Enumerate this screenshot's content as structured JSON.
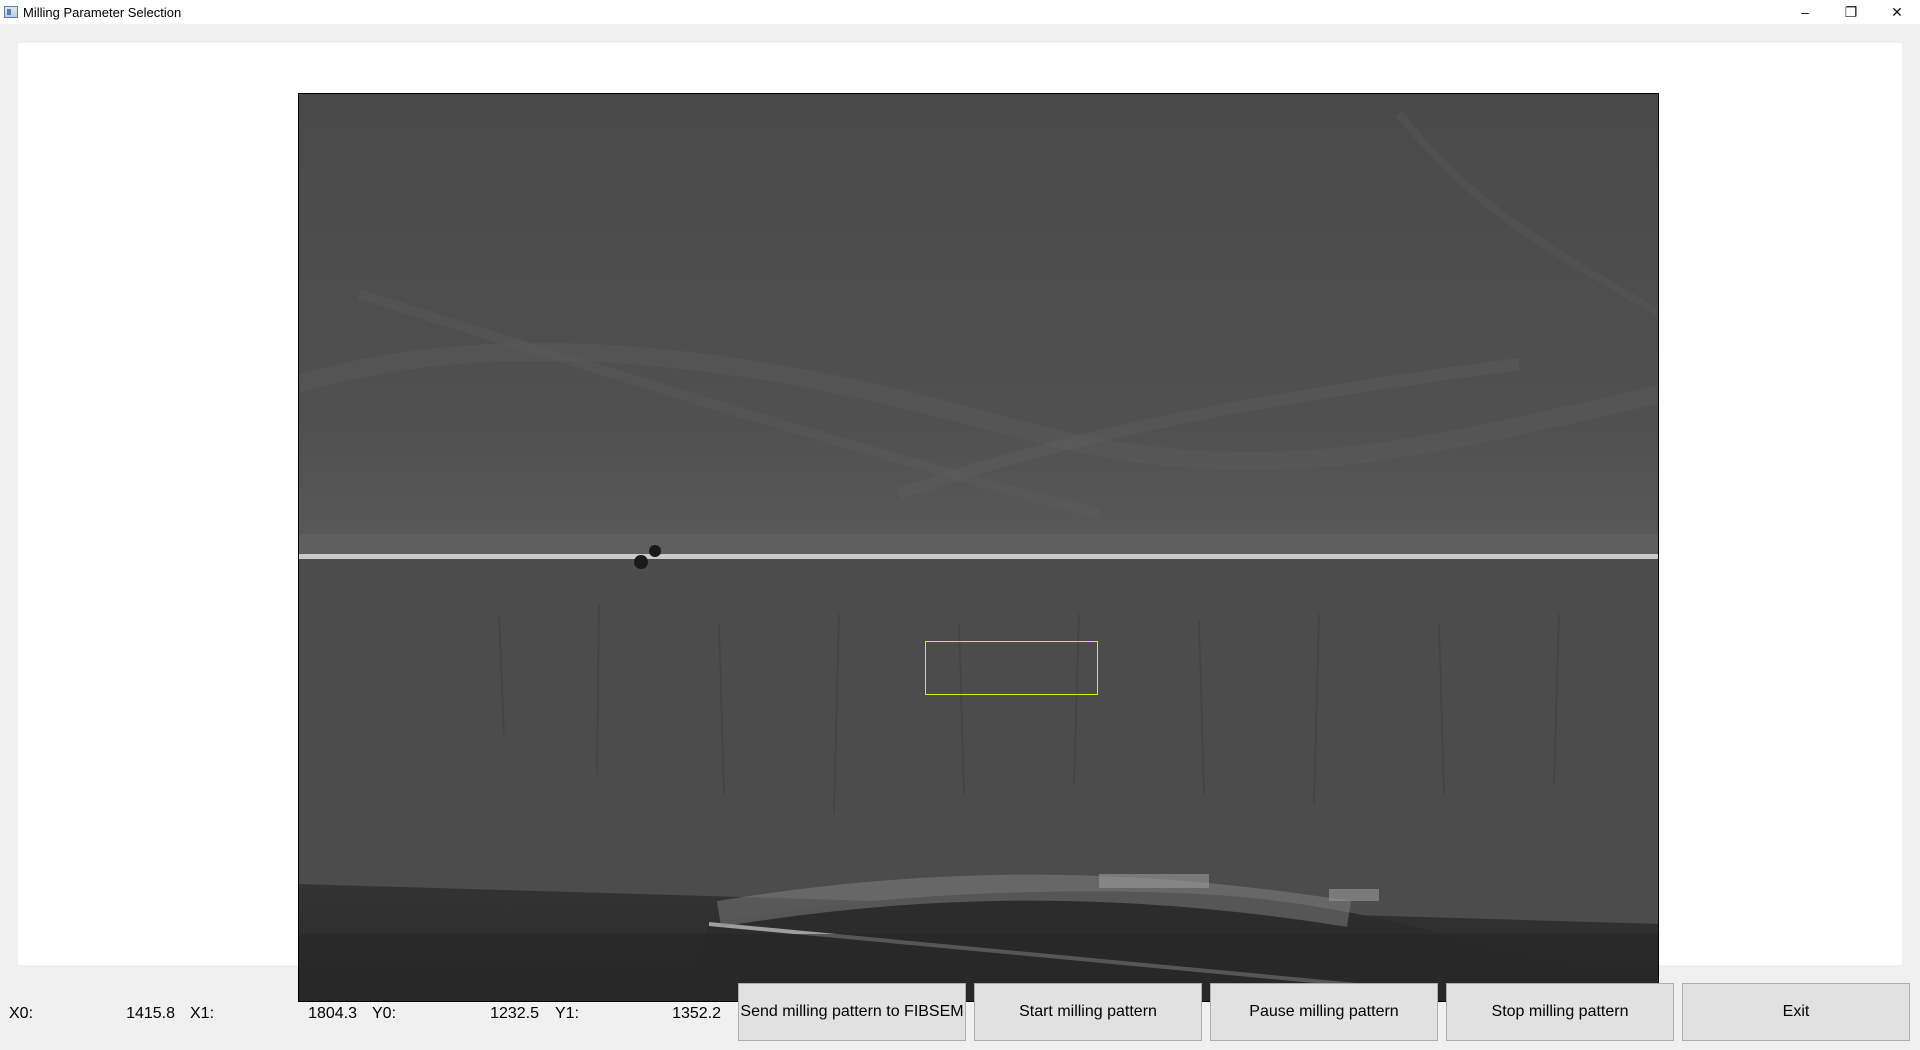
{
  "window": {
    "title": "Milling Parameter Selection",
    "controls": {
      "minimize": "–",
      "restore": "❐",
      "close": "✕"
    }
  },
  "coords": {
    "x0_label": "X0:",
    "x0_value": "1415.8",
    "x1_label": "X1:",
    "x1_value": "1804.3",
    "y0_label": "Y0:",
    "y0_value": "1232.5",
    "y1_label": "Y1:",
    "y1_value": "1352.2"
  },
  "buttons": {
    "send": "Send milling pattern to FIBSEM",
    "start": "Start milling pattern",
    "pause": "Pause milling pattern",
    "stop": "Stop milling pattern",
    "exit": "Exit"
  },
  "colors": {
    "selection_rect": "#e6e600",
    "window_bg": "#f0f0f0",
    "button_bg": "#e1e1e1"
  },
  "icons": {
    "app": "app-icon",
    "minimize": "minimize-icon",
    "restore": "restore-icon",
    "close": "close-icon"
  }
}
